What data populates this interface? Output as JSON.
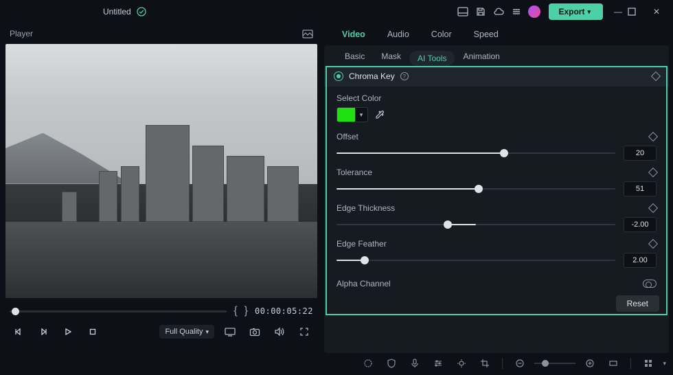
{
  "titlebar": {
    "doc_name": "Untitled",
    "export_label": "Export"
  },
  "player": {
    "title": "Player",
    "timecode": "00:00:05:22",
    "quality_label": "Full Quality"
  },
  "tabs_main": {
    "video": "Video",
    "audio": "Audio",
    "color": "Color",
    "speed": "Speed"
  },
  "tabs_sub": {
    "basic": "Basic",
    "mask": "Mask",
    "ai_tools": "AI Tools",
    "animation": "Animation"
  },
  "chroma": {
    "title": "Chroma Key",
    "select_color": "Select Color",
    "selected_hex": "#20e010",
    "offset": {
      "label": "Offset",
      "value": "20",
      "pct": 60
    },
    "tolerance": {
      "label": "Tolerance",
      "value": "51",
      "pct": 51
    },
    "edge_thickness": {
      "label": "Edge Thickness",
      "value": "-2.00",
      "pct": 40
    },
    "edge_feather": {
      "label": "Edge Feather",
      "value": "2.00",
      "pct": 10
    },
    "alpha_channel": "Alpha Channel"
  },
  "reset_label": "Reset"
}
